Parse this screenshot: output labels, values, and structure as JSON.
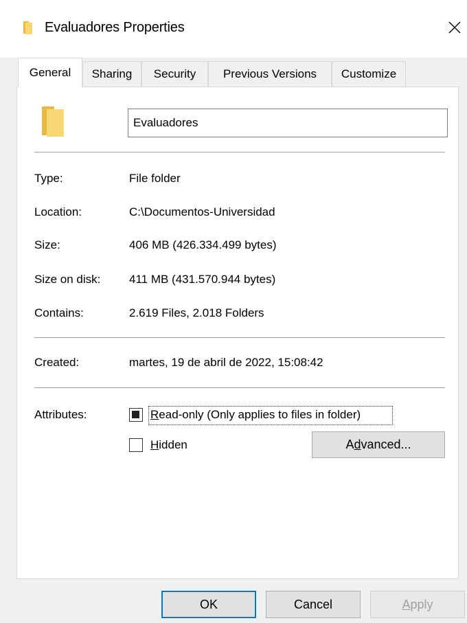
{
  "window": {
    "title": "Evaluadores Properties",
    "close_icon": "close-icon",
    "title_icon": "folder-icon"
  },
  "tabs": [
    {
      "label": "General",
      "active": true
    },
    {
      "label": "Sharing",
      "active": false
    },
    {
      "label": "Security",
      "active": false
    },
    {
      "label": "Previous Versions",
      "active": false
    },
    {
      "label": "Customize",
      "active": false
    }
  ],
  "general": {
    "folder_icon": "folder-icon",
    "name_value": "Evaluadores",
    "properties": [
      {
        "label": "Type:",
        "value": "File folder"
      },
      {
        "label": "Location:",
        "value": "C:\\Documentos-Universidad"
      },
      {
        "label": "Size:",
        "value": "406 MB (426.334.499 bytes)"
      },
      {
        "label": "Size on disk:",
        "value": "411 MB (431.570.944 bytes)"
      },
      {
        "label": "Contains:",
        "value": "2.619 Files, 2.018 Folders"
      }
    ],
    "created": {
      "label": "Created:",
      "value": "martes, 19 de abril de 2022, 15:08:42"
    },
    "attributes": {
      "label": "Attributes:",
      "readonly": {
        "label_first": "R",
        "label_rest": "ead-only (Only applies to files in folder)",
        "state": "indeterminate"
      },
      "hidden": {
        "label_first": "H",
        "label_rest": "idden",
        "state": "unchecked"
      },
      "advanced": {
        "pre": "A",
        "accel": "d",
        "post": "vanced..."
      }
    }
  },
  "buttons": {
    "ok": "OK",
    "cancel": "Cancel",
    "apply_first": "A",
    "apply_rest": "pply",
    "apply_enabled": false
  },
  "colors": {
    "accent": "#0078d7",
    "folder": "#f8d775",
    "folder_dark": "#e8b943"
  }
}
